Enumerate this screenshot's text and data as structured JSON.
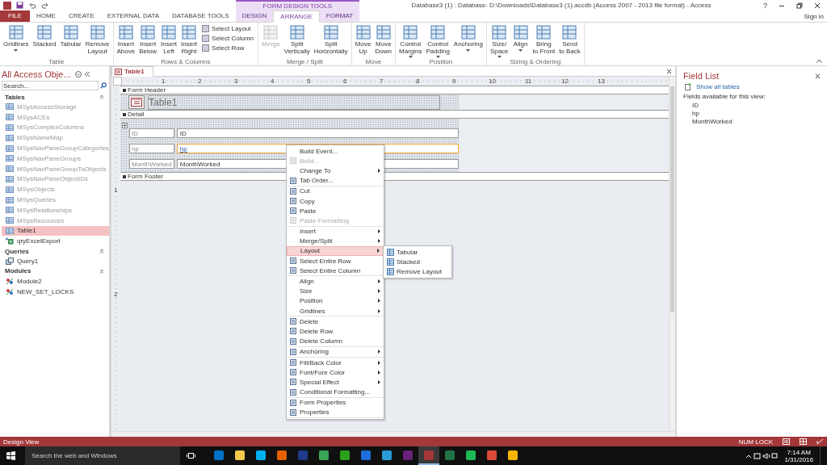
{
  "title_bar": {
    "contextual_header": "FORM DESIGN TOOLS",
    "title": "Database3 (1) : Database- D:\\Downloads\\Database3 (1).accdb (Access 2007 - 2013 file format) - Access",
    "help": "?",
    "sign_in": "Sign in"
  },
  "tabs": [
    {
      "label": "FILE",
      "kind": "file",
      "selected": false
    },
    {
      "label": "HOME",
      "kind": "normal",
      "selected": false
    },
    {
      "label": "CREATE",
      "kind": "normal",
      "selected": false
    },
    {
      "label": "EXTERNAL DATA",
      "kind": "normal",
      "selected": false
    },
    {
      "label": "DATABASE TOOLS",
      "kind": "normal",
      "selected": false
    },
    {
      "label": "DESIGN",
      "kind": "contextual",
      "selected": false
    },
    {
      "label": "ARRANGE",
      "kind": "contextual",
      "selected": true
    },
    {
      "label": "FORMAT",
      "kind": "contextual",
      "selected": false
    }
  ],
  "ribbon": [
    {
      "label": "Table",
      "buttons": [
        {
          "kind": "large",
          "lines": [
            "Gridlines"
          ],
          "dropdown": true,
          "disabled": false
        },
        {
          "kind": "large",
          "lines": [
            "Stacked"
          ],
          "dropdown": false,
          "disabled": false
        },
        {
          "kind": "large",
          "lines": [
            "Tabular"
          ],
          "dropdown": false,
          "disabled": false
        },
        {
          "kind": "large",
          "lines": [
            "Remove",
            "Layout"
          ],
          "dropdown": false,
          "disabled": false
        }
      ]
    },
    {
      "label": "Rows & Columns",
      "buttons": [
        {
          "kind": "large",
          "lines": [
            "Insert",
            "Above"
          ],
          "dropdown": false,
          "disabled": false
        },
        {
          "kind": "large",
          "lines": [
            "Insert",
            "Below"
          ],
          "dropdown": false,
          "disabled": false
        },
        {
          "kind": "large",
          "lines": [
            "Insert",
            "Left"
          ],
          "dropdown": false,
          "disabled": false
        },
        {
          "kind": "large",
          "lines": [
            "Insert",
            "Right"
          ],
          "dropdown": false,
          "disabled": false
        },
        {
          "kind": "small",
          "lines": [
            "Select Layout",
            "Select Column",
            "Select Row"
          ]
        }
      ]
    },
    {
      "label": "Merge / Split",
      "buttons": [
        {
          "kind": "large",
          "lines": [
            "Merge"
          ],
          "dropdown": false,
          "disabled": true
        },
        {
          "kind": "large",
          "lines": [
            "Split",
            "Vertically"
          ],
          "dropdown": false,
          "disabled": false
        },
        {
          "kind": "large",
          "lines": [
            "Split",
            "Horizontally"
          ],
          "dropdown": false,
          "disabled": false
        }
      ]
    },
    {
      "label": "Move",
      "buttons": [
        {
          "kind": "large",
          "lines": [
            "Move",
            "Up"
          ],
          "dropdown": false,
          "disabled": false
        },
        {
          "kind": "large",
          "lines": [
            "Move",
            "Down"
          ],
          "dropdown": false,
          "disabled": false
        }
      ]
    },
    {
      "label": "Position",
      "buttons": [
        {
          "kind": "large",
          "lines": [
            "Control",
            "Margins"
          ],
          "dropdown": true,
          "disabled": false
        },
        {
          "kind": "large",
          "lines": [
            "Control",
            "Padding"
          ],
          "dropdown": true,
          "disabled": false
        },
        {
          "kind": "large",
          "lines": [
            "Anchoring"
          ],
          "dropdown": true,
          "disabled": false
        }
      ]
    },
    {
      "label": "Sizing & Ordering",
      "buttons": [
        {
          "kind": "large",
          "lines": [
            "Size/",
            "Space"
          ],
          "dropdown": true,
          "disabled": false
        },
        {
          "kind": "large",
          "lines": [
            "Align"
          ],
          "dropdown": true,
          "disabled": false
        },
        {
          "kind": "large",
          "lines": [
            "Bring",
            "to Front"
          ],
          "dropdown": false,
          "disabled": false
        },
        {
          "kind": "large",
          "lines": [
            "Send",
            "to Back"
          ],
          "dropdown": false,
          "disabled": false
        }
      ]
    }
  ],
  "nav_pane": {
    "title": "All Access Obje...",
    "search": {
      "placeholder": "Search..."
    },
    "groups": [
      {
        "label": "Tables",
        "items": [
          {
            "label": "MSysAccessStorage",
            "kind": "table",
            "disabled": true,
            "selected": false
          },
          {
            "label": "MSysACEs",
            "kind": "table",
            "disabled": true,
            "selected": false
          },
          {
            "label": "MSysComplexColumns",
            "kind": "table",
            "disabled": true,
            "selected": false
          },
          {
            "label": "MSysNameMap",
            "kind": "table",
            "disabled": true,
            "selected": false
          },
          {
            "label": "MSysNavPaneGroupCategories",
            "kind": "table",
            "disabled": true,
            "selected": false
          },
          {
            "label": "MSysNavPaneGroups",
            "kind": "table",
            "disabled": true,
            "selected": false
          },
          {
            "label": "MSysNavPaneGroupToObjects",
            "kind": "table",
            "disabled": true,
            "selected": false
          },
          {
            "label": "MSysNavPaneObjectIDs",
            "kind": "table",
            "disabled": true,
            "selected": false
          },
          {
            "label": "MSysObjects",
            "kind": "table",
            "disabled": true,
            "selected": false
          },
          {
            "label": "MSysQueries",
            "kind": "table",
            "disabled": true,
            "selected": false
          },
          {
            "label": "MSysRelationships",
            "kind": "table",
            "disabled": true,
            "selected": false
          },
          {
            "label": "MSysResources",
            "kind": "table",
            "disabled": true,
            "selected": false
          },
          {
            "label": "Table1",
            "kind": "table",
            "disabled": false,
            "selected": true
          },
          {
            "label": "qryExcelExport",
            "kind": "linked",
            "disabled": false,
            "selected": false
          }
        ]
      },
      {
        "label": "Queries",
        "items": [
          {
            "label": "Query1",
            "kind": "query",
            "disabled": false,
            "selected": false
          }
        ]
      },
      {
        "label": "Modules",
        "items": [
          {
            "label": "Module2",
            "kind": "module",
            "disabled": false,
            "selected": false
          },
          {
            "label": "NEW_SET_LOCKS",
            "kind": "module",
            "disabled": false,
            "selected": false
          }
        ]
      }
    ]
  },
  "document": {
    "tab": "Table1",
    "ruler": [
      "1",
      "2",
      "3",
      "4",
      "5",
      "6",
      "7",
      "8",
      "9",
      "10",
      "11",
      "12",
      "13"
    ],
    "vertical_ruler": [
      "1",
      "2"
    ],
    "sections": {
      "header": "Form Header",
      "detail": "Detail",
      "footer": "Form Footer"
    },
    "form_title": "Table1",
    "fields": [
      {
        "label": "ID",
        "value": "ID",
        "selected": false
      },
      {
        "label": "hp",
        "value": "hp",
        "selected": true
      },
      {
        "label": "MonthWorked",
        "value": "MonthWorked",
        "selected": false
      }
    ]
  },
  "context_menu": {
    "groups": [
      [
        {
          "label": "Build Event...",
          "kind": "plain",
          "disabled": false,
          "submenu": false,
          "selected": false
        },
        {
          "label": "Build...",
          "kind": "icon",
          "disabled": true,
          "submenu": false,
          "selected": false
        },
        {
          "label": "Change To",
          "kind": "plain",
          "disabled": false,
          "submenu": true,
          "selected": false
        },
        {
          "label": "Tab Order...",
          "kind": "icon",
          "disabled": false,
          "submenu": false,
          "selected": false
        }
      ],
      [
        {
          "label": "Cut",
          "kind": "icon",
          "disabled": false,
          "submenu": false,
          "selected": false
        },
        {
          "label": "Copy",
          "kind": "icon",
          "disabled": false,
          "submenu": false,
          "selected": false
        },
        {
          "label": "Paste",
          "kind": "icon",
          "disabled": false,
          "submenu": false,
          "selected": false
        },
        {
          "label": "Paste Formatting",
          "kind": "icon",
          "disabled": true,
          "submenu": false,
          "selected": false
        }
      ],
      [
        {
          "label": "Insert",
          "kind": "plain",
          "disabled": false,
          "submenu": true,
          "selected": false
        },
        {
          "label": "Merge/Split",
          "kind": "plain",
          "disabled": false,
          "submenu": true,
          "selected": false
        },
        {
          "label": "Layout",
          "kind": "plain",
          "disabled": false,
          "submenu": true,
          "selected": true
        },
        {
          "label": "Select Entire Row",
          "kind": "icon",
          "disabled": false,
          "submenu": false,
          "selected": false
        },
        {
          "label": "Select Entire Column",
          "kind": "icon",
          "disabled": false,
          "submenu": false,
          "selected": false
        }
      ],
      [
        {
          "label": "Align",
          "kind": "plain",
          "disabled": false,
          "submenu": true,
          "selected": false
        },
        {
          "label": "Size",
          "kind": "plain",
          "disabled": false,
          "submenu": true,
          "selected": false
        },
        {
          "label": "Position",
          "kind": "plain",
          "disabled": false,
          "submenu": true,
          "selected": false
        },
        {
          "label": "Gridlines",
          "kind": "plain",
          "disabled": false,
          "submenu": true,
          "selected": false
        }
      ],
      [
        {
          "label": "Delete",
          "kind": "icon",
          "disabled": false,
          "submenu": false,
          "selected": false
        },
        {
          "label": "Delete Row",
          "kind": "icon",
          "disabled": false,
          "submenu": false,
          "selected": false
        },
        {
          "label": "Delete Column",
          "kind": "icon",
          "disabled": false,
          "submenu": false,
          "selected": false
        }
      ],
      [
        {
          "label": "Anchoring",
          "kind": "icon",
          "disabled": false,
          "submenu": true,
          "selected": false
        }
      ],
      [
        {
          "label": "Fill/Back Color",
          "kind": "icon",
          "disabled": false,
          "submenu": true,
          "selected": false
        },
        {
          "label": "Font/Fore Color",
          "kind": "icon",
          "disabled": false,
          "submenu": true,
          "selected": false
        },
        {
          "label": "Special Effect",
          "kind": "icon",
          "disabled": false,
          "submenu": true,
          "selected": false
        },
        {
          "label": "Conditional Formatting...",
          "kind": "icon",
          "disabled": false,
          "submenu": false,
          "selected": false
        }
      ],
      [
        {
          "label": "Form Properties",
          "kind": "icon",
          "disabled": false,
          "submenu": false,
          "selected": false
        },
        {
          "label": "Properties",
          "kind": "icon",
          "disabled": false,
          "submenu": false,
          "selected": false
        }
      ]
    ],
    "submenu": [
      "Tabular",
      "Stacked",
      "Remove Layout"
    ]
  },
  "field_list": {
    "title": "Field List",
    "link": "Show all tables",
    "caption": "Fields available for this view:",
    "fields": [
      "ID",
      "hp",
      "MonthWorked"
    ]
  },
  "status_bar": {
    "view": "Design View",
    "indicator": "NUM LOCK"
  },
  "taskbar": {
    "search": {
      "placeholder": "Search the web and Windows"
    },
    "apps": [
      {
        "color": "#0072c6",
        "selected": false
      },
      {
        "color": "#f2c94c",
        "selected": false
      },
      {
        "color": "#00aff0",
        "selected": false
      },
      {
        "color": "#e66000",
        "selected": false
      },
      {
        "color": "#1e3a8a",
        "selected": false
      },
      {
        "color": "#3aa655",
        "selected": false
      },
      {
        "color": "#2ca01c",
        "selected": false
      },
      {
        "color": "#1e6fd9",
        "selected": false
      },
      {
        "color": "#2b9bd8",
        "selected": false
      },
      {
        "color": "#68217a",
        "selected": false
      },
      {
        "color": "#a4373a",
        "selected": true
      },
      {
        "color": "#217346",
        "selected": false
      },
      {
        "color": "#1db954",
        "selected": false
      },
      {
        "color": "#dd4b39",
        "selected": false
      },
      {
        "color": "#f7b500",
        "selected": false
      }
    ],
    "time": "7:14 AM",
    "date": "1/31/2016"
  }
}
